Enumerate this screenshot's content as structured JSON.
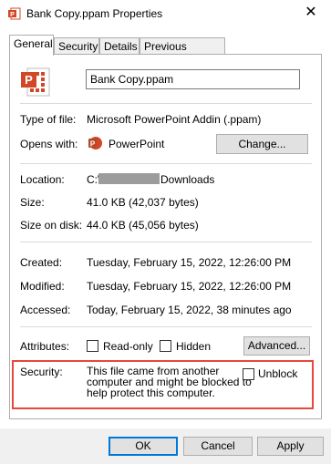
{
  "window": {
    "title": "Bank Copy.ppam Properties",
    "close_glyph": "✕"
  },
  "tabs": [
    {
      "label": "General"
    },
    {
      "label": "Security"
    },
    {
      "label": "Details"
    },
    {
      "label": "Previous Versions"
    }
  ],
  "general": {
    "file_name": "Bank Copy.ppam",
    "type_label": "Type of file:",
    "type_value": "Microsoft PowerPoint Addin (.ppam)",
    "opens_label": "Opens with:",
    "opens_value": "PowerPoint",
    "change_label": "Change...",
    "location_label": "Location:",
    "location_prefix": "C:\\",
    "location_suffix": "Downloads",
    "size_label": "Size:",
    "size_value": "41.0 KB (42,037 bytes)",
    "size_on_disk_label": "Size on disk:",
    "size_on_disk_value": "44.0 KB (45,056 bytes)",
    "created_label": "Created:",
    "created_value": "Tuesday, February 15, 2022, 12:26:00 PM",
    "modified_label": "Modified:",
    "modified_value": "Tuesday, February 15, 2022, 12:26:00 PM",
    "accessed_label": "Accessed:",
    "accessed_value": "Today, February 15, 2022, 38 minutes ago",
    "attributes_label": "Attributes:",
    "readonly_label": "Read-only",
    "hidden_label": "Hidden",
    "advanced_label": "Advanced...",
    "security_label": "Security:",
    "security_line1": "This file came from another",
    "security_line2": "computer and might be blocked to",
    "security_line3": "help protect this computer.",
    "unblock_label": "Unblock"
  },
  "buttons": {
    "ok": "OK",
    "cancel": "Cancel",
    "apply": "Apply"
  },
  "colors": {
    "highlight_border": "#e8473b",
    "powerpoint_orange": "#d24726",
    "default_button_border": "#0078d7"
  },
  "icons": {
    "app": "powerpoint-addin-icon",
    "opens_with": "powerpoint-icon"
  }
}
